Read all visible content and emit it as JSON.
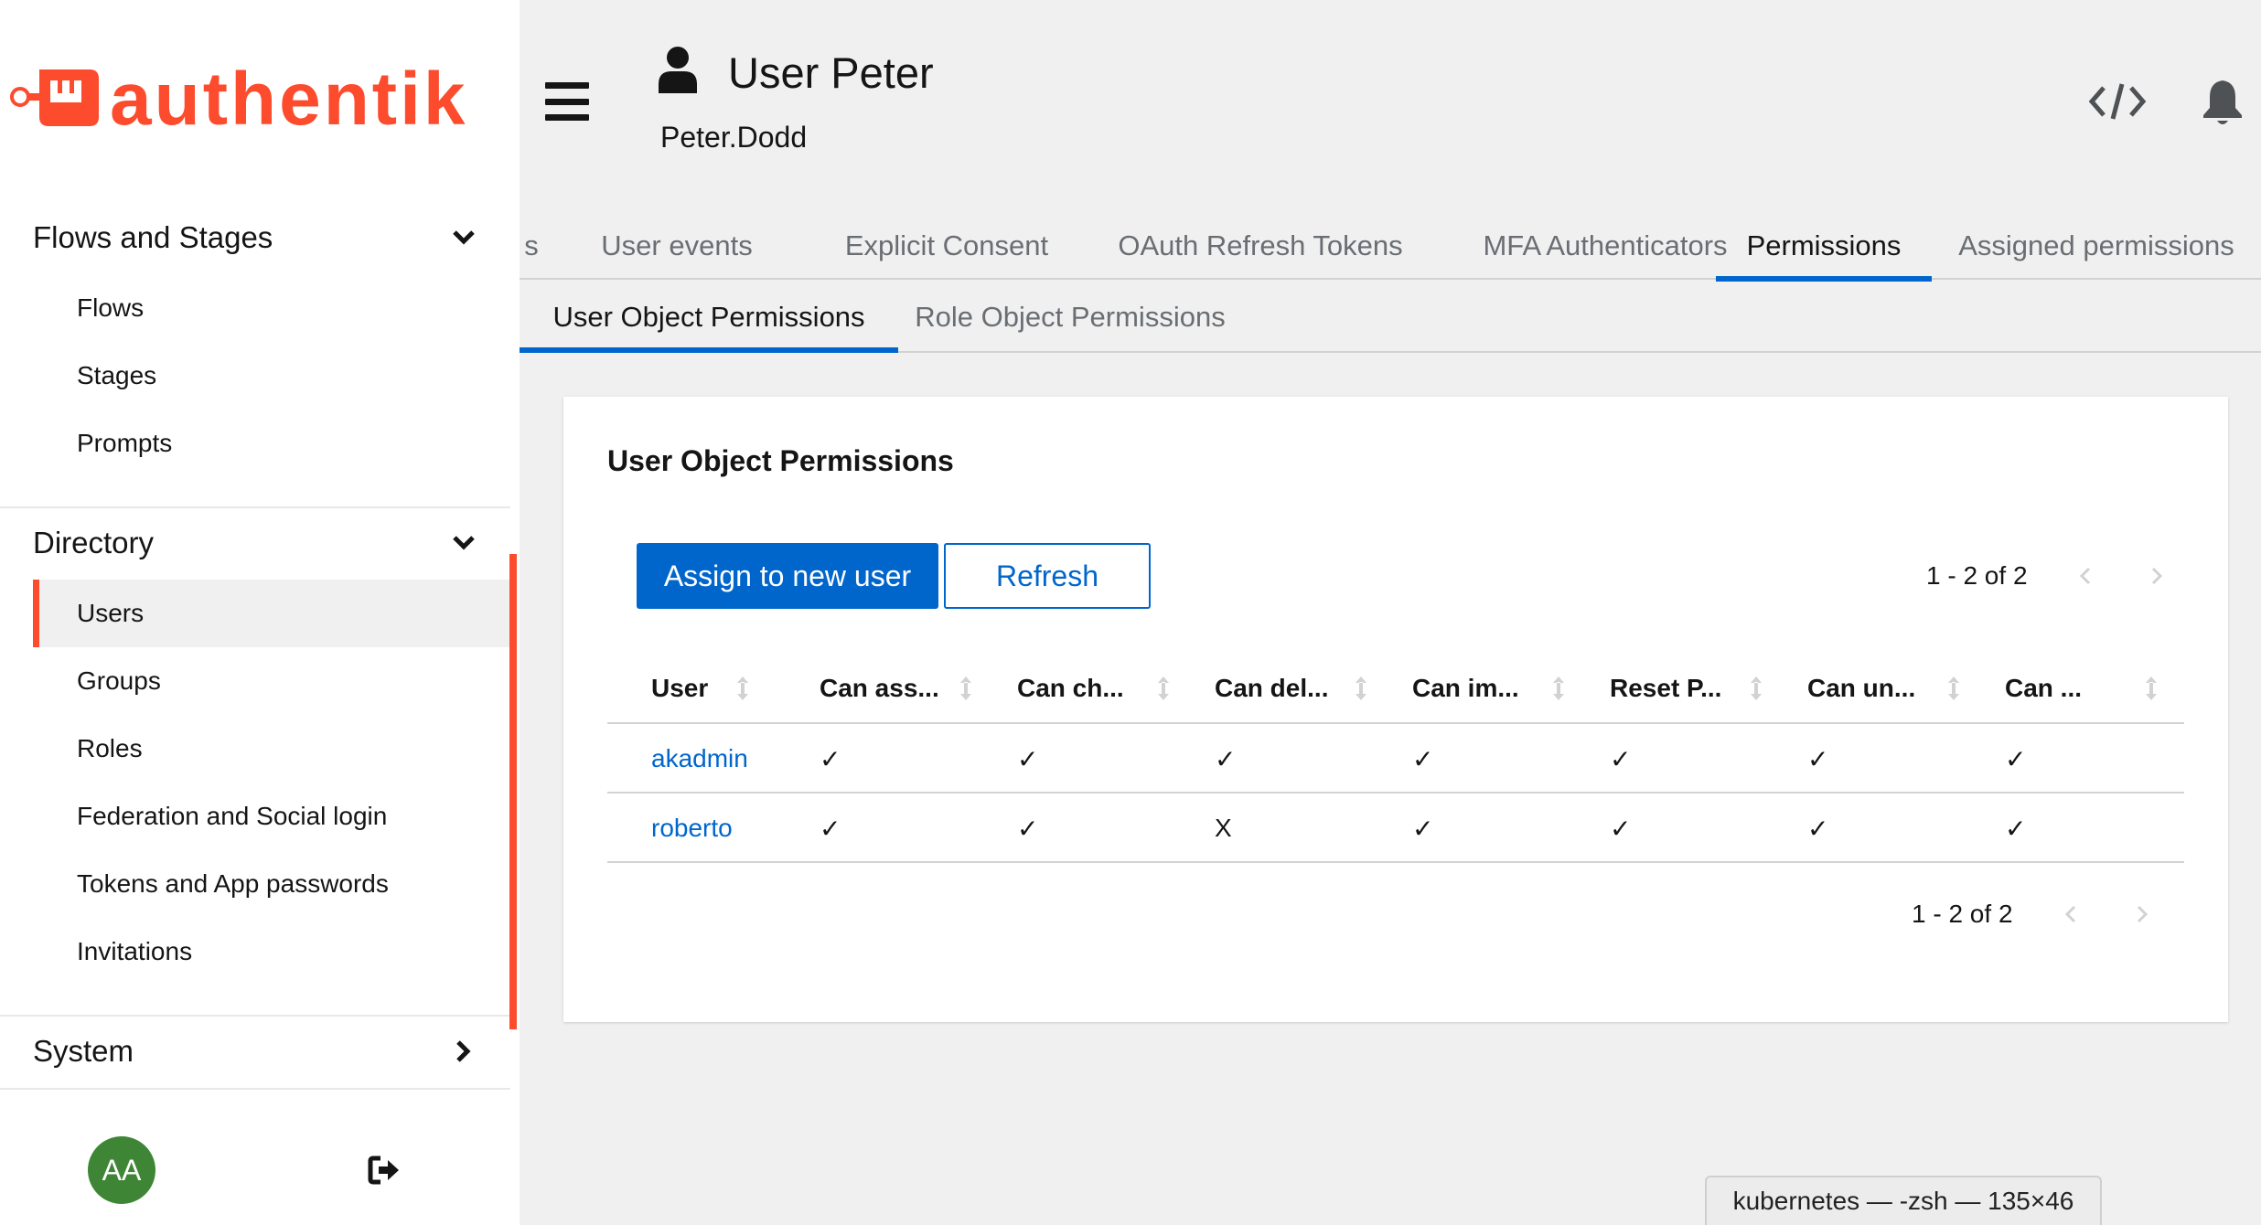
{
  "brand": {
    "name": "authentik",
    "accent": "#fd4b2d"
  },
  "sidebar": {
    "sections": [
      {
        "label": "Flows and Stages",
        "expanded": true,
        "items": [
          "Flows",
          "Stages",
          "Prompts"
        ]
      },
      {
        "label": "Directory",
        "expanded": true,
        "items": [
          "Users",
          "Groups",
          "Roles",
          "Federation and Social login",
          "Tokens and App passwords",
          "Invitations"
        ],
        "active": "Users"
      },
      {
        "label": "System",
        "expanded": false,
        "items": []
      }
    ],
    "avatar_initials": "AA",
    "avatar_color": "#3e8635"
  },
  "header": {
    "title": "User Peter",
    "subtitle": "Peter.Dodd"
  },
  "tabs": {
    "items": [
      "s",
      "User events",
      "Explicit Consent",
      "OAuth Refresh Tokens",
      "MFA Authenticators",
      "Permissions",
      "Assigned permissions"
    ],
    "active": "Permissions"
  },
  "subtabs": {
    "items": [
      "User Object Permissions",
      "Role Object Permissions"
    ],
    "active": "User Object Permissions"
  },
  "card": {
    "title": "User Object Permissions",
    "assign_label": "Assign to new user",
    "refresh_label": "Refresh",
    "pagination_text": "1 - 2 of 2",
    "columns": [
      "User",
      "Can ass...",
      "Can ch...",
      "Can del...",
      "Can im...",
      "Reset P...",
      "Can un...",
      "Can ..."
    ],
    "rows": [
      {
        "user": "akadmin",
        "values": [
          "✓",
          "✓",
          "✓",
          "✓",
          "✓",
          "✓",
          "✓"
        ]
      },
      {
        "user": "roberto",
        "values": [
          "✓",
          "✓",
          "X",
          "✓",
          "✓",
          "✓",
          "✓"
        ]
      }
    ]
  },
  "terminal_tooltip": "kubernetes — -zsh — 135×46",
  "colors": {
    "primary": "#0066cc",
    "link": "#0066cc",
    "background": "#f0f0f0"
  }
}
